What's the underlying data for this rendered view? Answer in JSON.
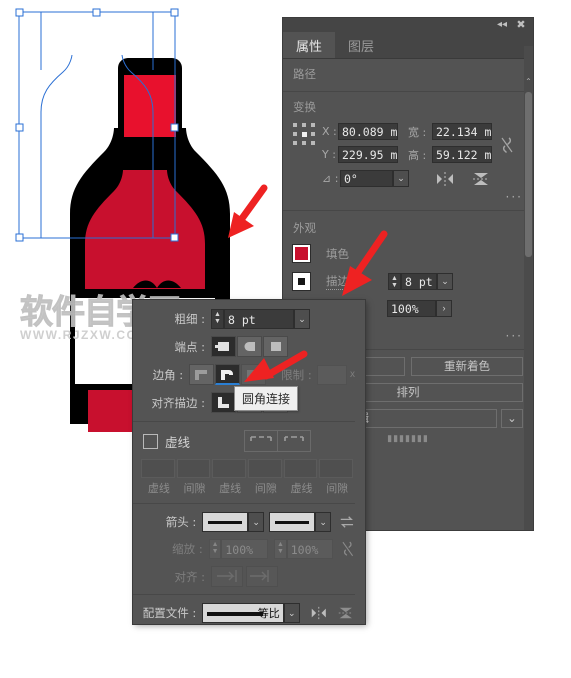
{
  "watermark": {
    "cn": "软件自学网",
    "en": "WWW.RJZXW.COM"
  },
  "properties_panel": {
    "titlebar": {
      "collapse_icon": "collapse-icon",
      "close_icon": "close-icon"
    },
    "tabs": [
      {
        "label": "属性",
        "active": true
      },
      {
        "label": "图层",
        "active": false
      }
    ],
    "path_section": {
      "label": "路径"
    },
    "transform": {
      "label": "变换",
      "x_label": "X :",
      "x_value": "80.089 m",
      "y_label": "Y :",
      "y_value": "229.95 m",
      "w_label": "宽 :",
      "w_value": "22.134 m",
      "h_label": "高 :",
      "h_value": "59.122 m",
      "angle_label": "⊿ :",
      "angle_value": "0°",
      "link_icon": "broken-link-icon",
      "flip_h_icon": "flip-horizontal-icon",
      "flip_v_icon": "flip-vertical-icon",
      "more_options": "···"
    },
    "appearance": {
      "label": "外观",
      "fill_label": "填色",
      "fill_color": "#c8102e",
      "stroke_label": "描边",
      "stroke_weight": "8 pt",
      "opacity": "100%",
      "more_options": "···"
    },
    "quick_actions": {
      "recolor_label": "重新着色",
      "arrange_label": "排列",
      "global_edit_label": "启动全局编辑"
    }
  },
  "stroke_panel": {
    "weight_label": "粗细 :",
    "weight_value": "8 pt",
    "cap_label": "端点 :",
    "cap_options": [
      "butt-cap-icon",
      "round-cap-icon",
      "projecting-cap-icon"
    ],
    "corner_label": "边角 :",
    "corner_options": [
      "miter-join-icon",
      "round-join-icon",
      "bevel-join-icon"
    ],
    "corner_selected_index": 1,
    "limit_label": "限制 :",
    "limit_value": "",
    "limit_unit": "x",
    "align_label": "对齐描边 :",
    "align_options": [
      "align-center-icon",
      "align-inside-icon",
      "align-outside-icon"
    ],
    "dashed_label": "虚线",
    "dash_preserve_icons": [
      "dash-preserve-exact-icon",
      "dash-adjust-corners-icon"
    ],
    "dash_fields": [
      "",
      "",
      "",
      "",
      "",
      ""
    ],
    "dash_captions": [
      "虚线",
      "间隙",
      "虚线",
      "间隙",
      "虚线",
      "间隙"
    ],
    "arrow_label": "箭头 :",
    "arrow_swap_icon": "swap-arrows-icon",
    "scale_label": "缩放 :",
    "scale_start": "100%",
    "scale_end": "100%",
    "scale_link_icon": "broken-link-icon",
    "align_arrow_label": "对齐 :",
    "align_arrow_icons": [
      "extend-beyond-icon",
      "place-at-end-icon"
    ],
    "profile_label": "配置文件 :",
    "profile_value": "等比",
    "profile_flip_h_icon": "flip-horizontal-icon",
    "profile_flip_v_icon": "flip-vertical-icon"
  },
  "tooltip": {
    "text": "圆角连接"
  },
  "annotations": {
    "arrow_color": "#ee2222",
    "arrows": [
      "arrow-to-artwork-corner",
      "arrow-to-stroke-label",
      "arrow-to-round-join"
    ]
  },
  "artwork": {
    "name": "bottle-illustration",
    "fill_color": "#c8102e",
    "outline_color": "#000000",
    "selection_color": "#2a6fd4"
  }
}
